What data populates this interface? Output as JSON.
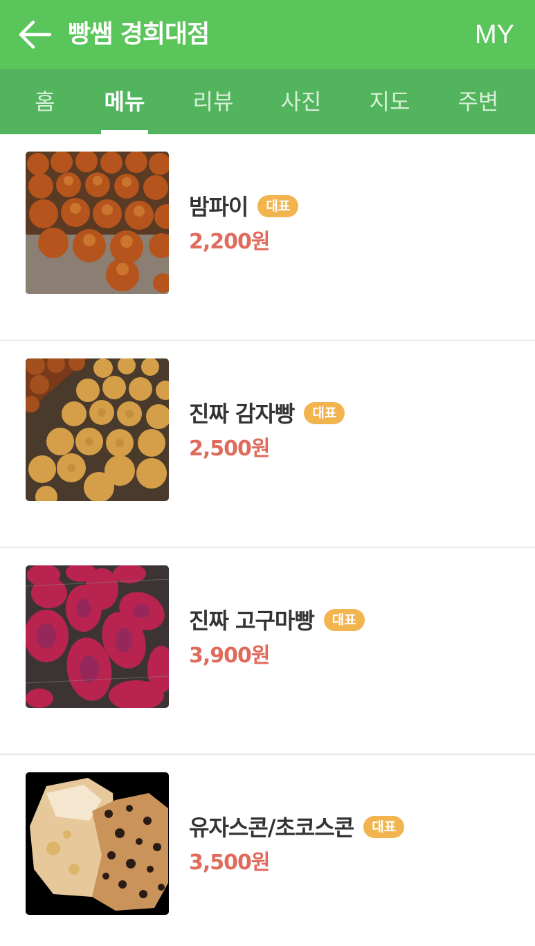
{
  "header": {
    "title": "빵쌤 경희대점",
    "my_label": "MY",
    "bg_color": "#5ac55a"
  },
  "tabs": [
    {
      "label": "홈",
      "active": false
    },
    {
      "label": "메뉴",
      "active": true
    },
    {
      "label": "리뷰",
      "active": false
    },
    {
      "label": "사진",
      "active": false
    },
    {
      "label": "지도",
      "active": false
    },
    {
      "label": "주변",
      "active": false
    }
  ],
  "menu": [
    {
      "name": "밤파이",
      "badge": "대표",
      "price": "2,200원"
    },
    {
      "name": "진짜 감자빵",
      "badge": "대표",
      "price": "2,500원"
    },
    {
      "name": "진짜 고구마빵",
      "badge": "대표",
      "price": "3,900원"
    },
    {
      "name": "유자스콘/초코스콘",
      "badge": "대표",
      "price": "3,500원"
    }
  ],
  "colors": {
    "tab_bg": "#52b55d",
    "badge": "#f2b44f",
    "price": "#e06a5b"
  }
}
